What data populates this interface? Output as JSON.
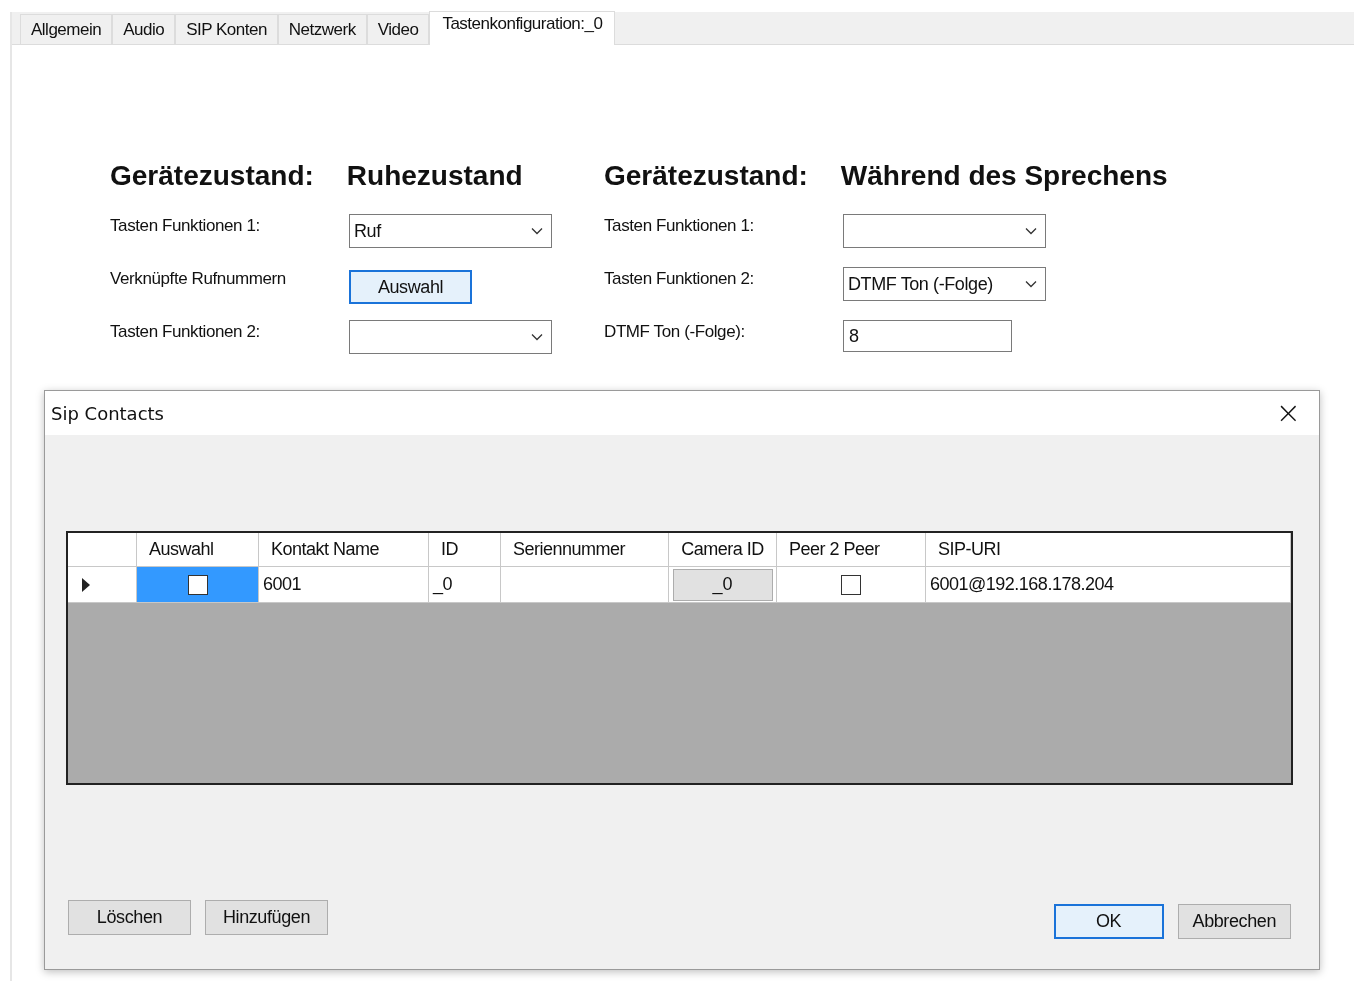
{
  "tabs": [
    {
      "label": "Allgemein",
      "selected": false
    },
    {
      "label": "Audio",
      "selected": false
    },
    {
      "label": "SIP Konten",
      "selected": false
    },
    {
      "label": "Netzwerk",
      "selected": false
    },
    {
      "label": "Video",
      "selected": false
    },
    {
      "label": "Tastenkonfiguration:_0",
      "selected": true
    }
  ],
  "sections": [
    {
      "heading": "Gerätezustand:",
      "state": "Ruhezustand",
      "rows": [
        {
          "label": "Tasten Funktionen 1:",
          "kind": "combo",
          "value": "Ruf"
        },
        {
          "label": "Verknüpfte Rufnummern",
          "kind": "button",
          "value": "Auswahl",
          "focused": true
        },
        {
          "label": "Tasten Funktionen 2:",
          "kind": "combo",
          "value": ""
        }
      ]
    },
    {
      "heading": "Gerätezustand:",
      "state": "Während des Sprechens",
      "rows": [
        {
          "label": "Tasten Funktionen 1:",
          "kind": "combo",
          "value": ""
        },
        {
          "label": "Tasten Funktionen 2:",
          "kind": "combo",
          "value": "DTMF Ton (-Folge)"
        },
        {
          "label": "DTMF Ton (-Folge):",
          "kind": "text",
          "value": "8"
        }
      ]
    }
  ],
  "dialog": {
    "title": "Sip Contacts",
    "close": "×",
    "grid": {
      "columns": [
        "Auswahl",
        "Kontakt Name",
        "ID",
        "Seriennummer",
        "Camera ID",
        "Peer 2 Peer",
        "SIP-URI"
      ],
      "rows": [
        {
          "current": true,
          "cells": [
            {
              "kind": "check",
              "checked": false,
              "selected": true
            },
            {
              "kind": "text",
              "value": "6001",
              "selected": false
            },
            {
              "kind": "text",
              "value": "_0",
              "selected": false
            },
            {
              "kind": "text",
              "selected": false
            },
            {
              "kind": "button",
              "value": "_0",
              "selected": false
            },
            {
              "kind": "check",
              "checked": false,
              "selected": false
            },
            {
              "kind": "text",
              "value": "6001@192.168.178.204",
              "selected": false
            }
          ]
        }
      ]
    },
    "buttons_left": [
      {
        "label": "Löschen",
        "default": false
      },
      {
        "label": "Hinzufügen",
        "default": false
      }
    ],
    "buttons_right": [
      {
        "label": "OK",
        "default": true
      },
      {
        "label": "Abbrechen",
        "default": false
      }
    ]
  }
}
